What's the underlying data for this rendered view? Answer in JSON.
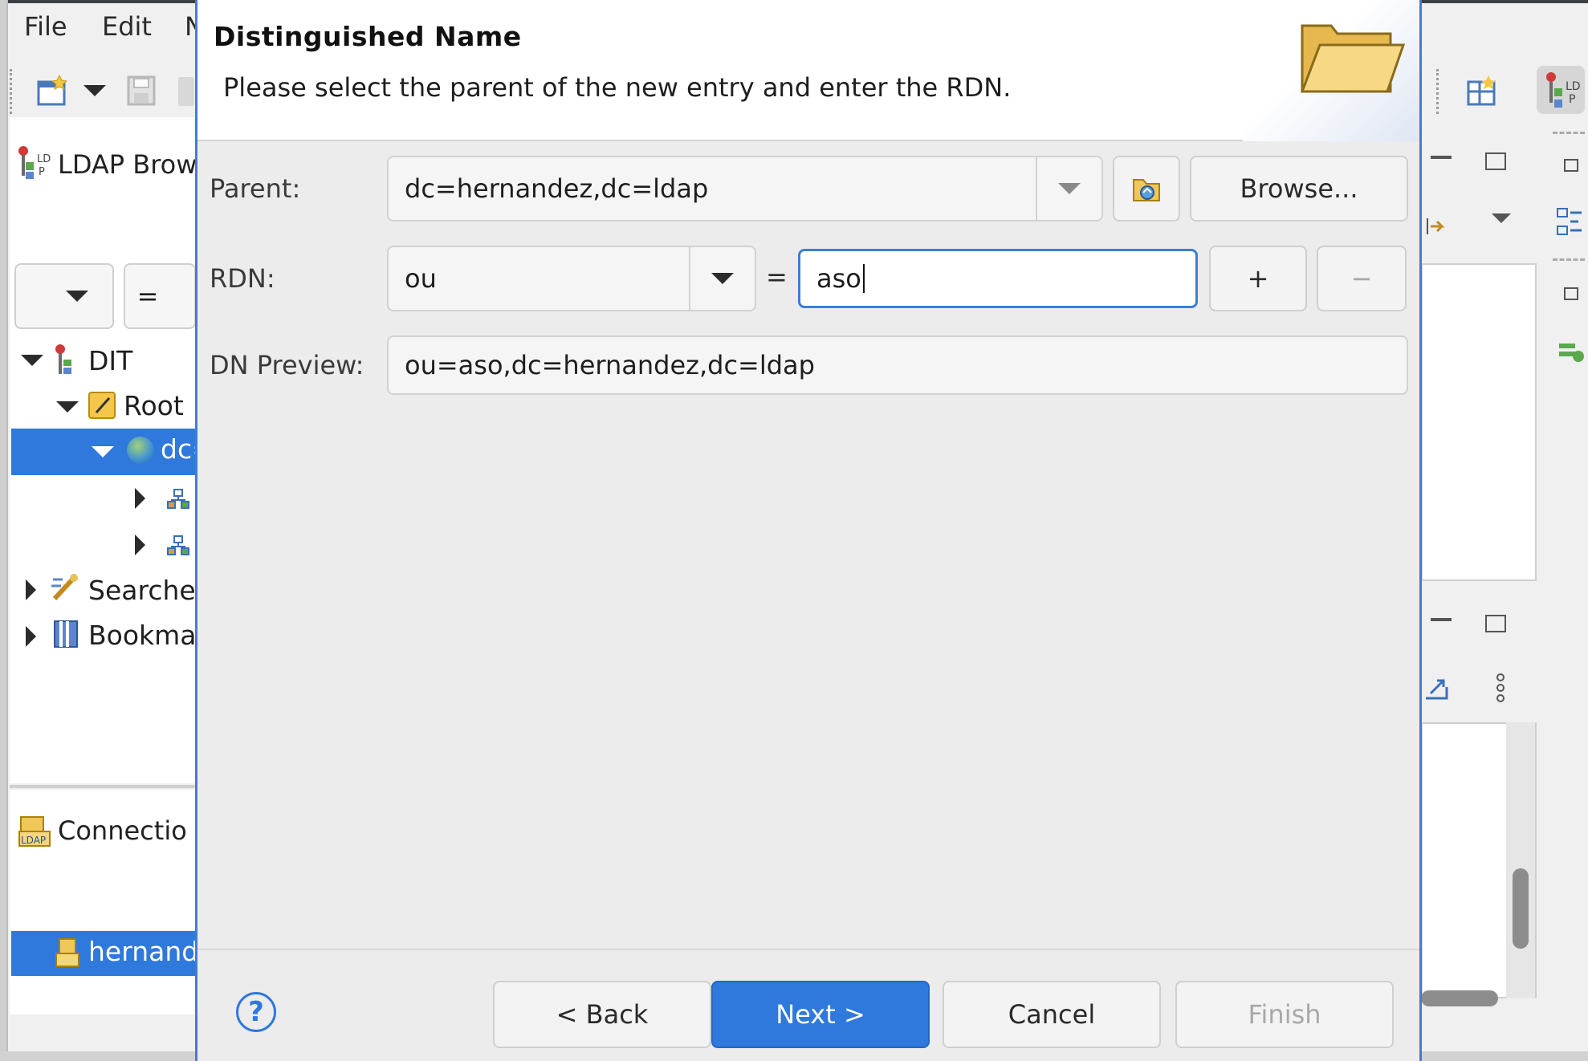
{
  "menubar": {
    "file": "File",
    "edit": "Edit",
    "partial": "N"
  },
  "left_panel": {
    "ldap_browser_title": "LDAP Brow",
    "filter_eq": "=",
    "tree": [
      {
        "label": "DIT",
        "icon": "dit-icon"
      },
      {
        "label": "Root",
        "icon": "root-icon"
      },
      {
        "label": "dc=",
        "icon": "globe-icon",
        "selected": true
      },
      {
        "label": "",
        "icon": "org-unit-icon"
      },
      {
        "label": "",
        "icon": "org-unit-icon"
      },
      {
        "label": "Searche",
        "icon": "search-icon"
      },
      {
        "label": "Bookma",
        "icon": "bookmark-icon"
      }
    ],
    "connections_title": "Connectio",
    "connection_item": "hernand"
  },
  "dialog": {
    "title": "Distinguished Name",
    "description": "Please select the parent of the new entry and enter the RDN.",
    "parent_label": "Parent:",
    "parent_value": "dc=hernandez,dc=ldap",
    "browse_label": "Browse...",
    "rdn_label": "RDN:",
    "rdn_type": "ou",
    "equals": "=",
    "rdn_value": "aso",
    "plus_label": "+",
    "minus_label": "−",
    "dn_preview_label": "DN Preview:",
    "dn_preview_value": "ou=aso,dc=hernandez,dc=ldap",
    "help": "?",
    "back_label": "< Back",
    "next_label": "Next >",
    "cancel_label": "Cancel",
    "finish_label": "Finish"
  },
  "colors": {
    "accent": "#2f78dc",
    "selection": "#2f78dc",
    "dialog_border": "#3d7ed6"
  }
}
